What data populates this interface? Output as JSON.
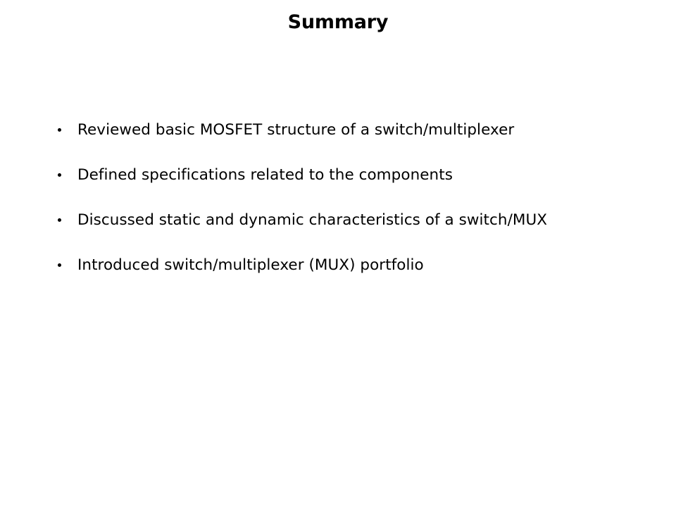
{
  "slide": {
    "title": "Summary",
    "background_color": "#ffffff",
    "text_color": "#000000",
    "bullet_marker": "round-dot",
    "bullets": [
      {
        "text": "Reviewed basic MOSFET structure of a switch/multiplexer"
      },
      {
        "text": "Defined specifications related to the components"
      },
      {
        "text": "Discussed static and dynamic characteristics of a switch/MUX"
      },
      {
        "text": "Introduced switch/multiplexer  (MUX) portfolio"
      }
    ]
  }
}
